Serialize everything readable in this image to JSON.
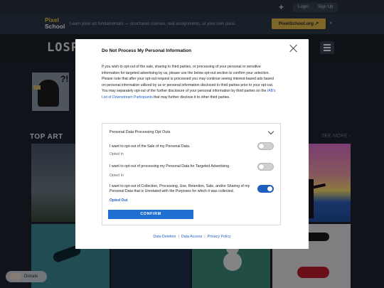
{
  "topbar": {
    "plus": "+",
    "login": "Login",
    "signup": "Sign Up"
  },
  "promo": {
    "logo_line1": "Pixel",
    "logo_line2": "School",
    "text": "Learn pixel art fundamentals — structured courses, real assignments, at your own pace.",
    "button": "PixelSchool.org ↗",
    "close": "×"
  },
  "header": {
    "brand": "LOSP"
  },
  "section": {
    "title": "TOP ART",
    "see_more": "SEE MORE ›"
  },
  "donate": {
    "label": "Donate"
  },
  "dialog": {
    "title": "Do Not Process My Personal Information",
    "body_main": "If you wish to opt-out of the sale, sharing to third parties, or processing of your personal or sensitive information for targeted advertising by us, please use the below opt-out section to confirm your selection. Please note that after your opt-out request is processed you may continue seeing interest-based ads based on personal information utilized by us or personal information disclosed to third parties prior to your opt-out. You may separately opt-out of the further disclosure of your personal information by third parties on the ",
    "body_link": "IAB's List of Downstream Participants",
    "body_tail": " that may further disclose it to other third parties.",
    "panel_header": "Personal Data Processing Opt Outs",
    "options": [
      {
        "label": "I want to opt-out of the Sale of my Personal Data.",
        "status": "Opted In"
      },
      {
        "label": "I want to opt-out of processing my Personal Data for Targeted Advertising.",
        "status": "Opted In"
      },
      {
        "label": "I want to opt-out of Collection, Processing, Use, Retention, Sale, and/or Sharing of my Personal Data that is Unrelated with the Purposes for which it was collected.",
        "status": "Opted Out"
      }
    ],
    "confirm": "CONFIRM",
    "links": {
      "deletion": "Data Deletion",
      "access": "Data Access",
      "privacy": "Privacy Policy",
      "sep": "|"
    }
  }
}
